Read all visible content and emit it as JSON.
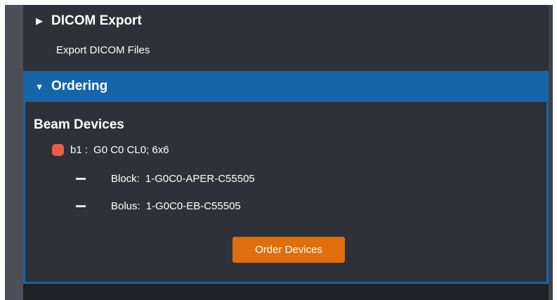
{
  "dicom_export": {
    "header_label": "DICOM Export",
    "caret": "▶",
    "item_label": "Export DICOM Files"
  },
  "ordering": {
    "header_label": "Ordering",
    "caret": "▼",
    "section_title": "Beam Devices",
    "beam": {
      "id": "b1 :",
      "description": "G0 C0 CL0; 6x6",
      "status_color": "#ef5a47"
    },
    "devices": [
      {
        "type": "Block:",
        "code": "1-G0C0-APER-C55505"
      },
      {
        "type": "Bolus:",
        "code": "1-G0C0-EB-C55505"
      }
    ],
    "order_button_label": "Order Devices"
  },
  "colors": {
    "panel_bg": "#2e3238",
    "accent_blue": "#1565a8",
    "button_orange": "#e06e0c"
  }
}
